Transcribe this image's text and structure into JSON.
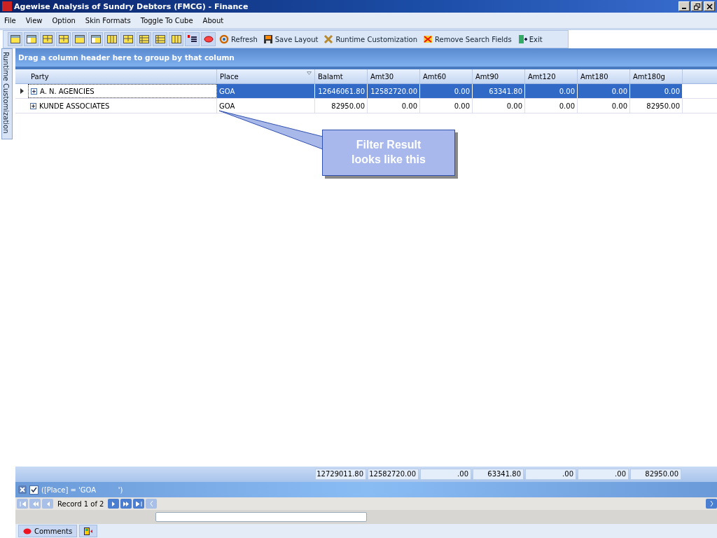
{
  "window": {
    "title": "Agewise Analysis of Sundry Debtors (FMCG) - Finance"
  },
  "menu": [
    "File",
    "View",
    "Option",
    "Skin Formats",
    "Toggle To Cube",
    "About"
  ],
  "toolbar": [
    {
      "label": "Refresh",
      "kind": "refresh"
    },
    {
      "label": "Save Layout",
      "kind": "save"
    },
    {
      "label": "Runtime Customization",
      "kind": "tools"
    },
    {
      "label": "Remove Search Fields",
      "kind": "remove"
    },
    {
      "label": "Exit",
      "kind": "exit"
    }
  ],
  "side_tab": "Runtime Customization",
  "group_panel": "Drag a column header here to group by that column",
  "table": {
    "columns": [
      "Party",
      "Place",
      "Balamt",
      "Amt30",
      "Amt60",
      "Amt90",
      "Amt120",
      "Amt180",
      "Amt180g"
    ],
    "rows": [
      {
        "selected": true,
        "expanded": false,
        "cells": [
          "A. N. AGENCIES",
          "GOA",
          "12646061.80",
          "12582720.00",
          "0.00",
          "63341.80",
          "0.00",
          "0.00",
          "0.00"
        ]
      },
      {
        "selected": false,
        "expanded": false,
        "cells": [
          "KUNDE ASSOCIATES",
          "GOA",
          "82950.00",
          "0.00",
          "0.00",
          "0.00",
          "0.00",
          "0.00",
          "82950.00"
        ]
      }
    ],
    "totals": [
      "12729011.80",
      "12582720.00",
      ".00",
      "63341.80",
      ".00",
      ".00",
      "82950.00"
    ]
  },
  "filter": {
    "checked": true,
    "text": "([Place] = 'GOA          ')"
  },
  "navigator": {
    "text": "Record 1 of 2"
  },
  "callout": "Filter Result looks like this",
  "bottom_tabs": [
    "Comments"
  ]
}
